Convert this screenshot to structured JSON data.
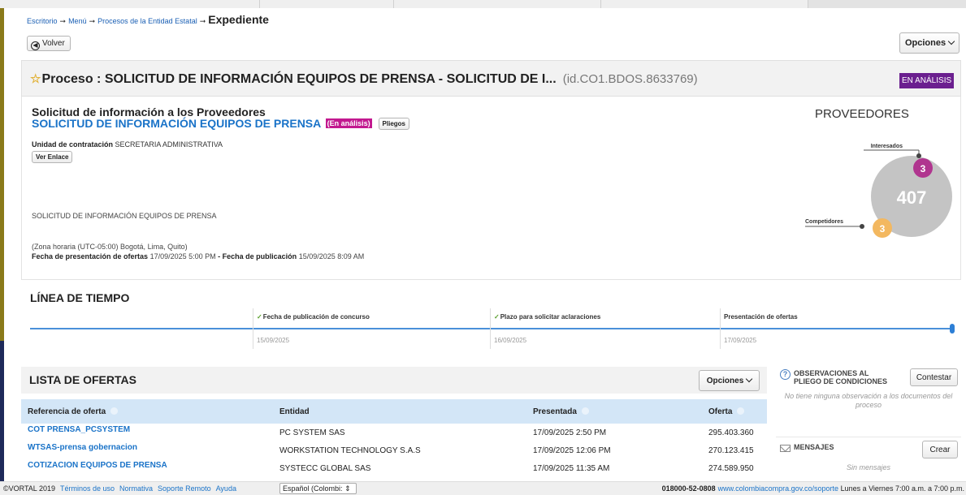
{
  "breadcrumb": {
    "items": [
      "Escritorio",
      "Menú",
      "Procesos de la Entidad Estatal"
    ],
    "current": "Expediente"
  },
  "toolbar": {
    "volver_label": "Volver",
    "opciones_label": "Opciones"
  },
  "proceso": {
    "title": "Proceso : SOLICITUD DE INFORMACIÓN EQUIPOS DE PRENSA - SOLICITUD DE I...",
    "id": "(id.CO1.BDOS.8633769)",
    "status": "EN ANÁLISIS"
  },
  "detail": {
    "heading": "Solicitud de información a los Proveedores",
    "subtitle": "SOLICITUD DE INFORMACIÓN EQUIPOS DE PRENSA",
    "badge": "(En análisis)",
    "pliegos_label": "Pliegos",
    "unidad_label": "Unidad de contratación",
    "unidad_value": "SECRETARIA ADMINISTRATIVA",
    "ver_enlace_label": "Ver Enlace",
    "description": "SOLICITUD DE INFORMACIÓN EQUIPOS DE PRENSA",
    "zona": "(Zona horaria (UTC-05:00) Bogotá, Lima, Quito)",
    "fecha_presentacion_label": "Fecha de presentación de ofertas",
    "fecha_presentacion_value": "17/09/2025 5:00 PM",
    "separator": "-",
    "fecha_publicacion_label": "Fecha de publicación",
    "fecha_publicacion_value": "15/09/2025 8:09 AM"
  },
  "proveedores": {
    "title": "PROVEEDORES",
    "total": "407",
    "interesados_label": "Interesados",
    "interesados_count": "3",
    "competidores_label": "Competidores",
    "competidores_count": "3",
    "colors": {
      "total": "#c4c4c4",
      "interesados": "#b0358f",
      "competidores": "#f3b860"
    }
  },
  "timeline": {
    "title": "LÍNEA DE TIEMPO",
    "milestones": [
      {
        "label": "Fecha de publicación de concurso",
        "date": "15/09/2025",
        "done": true
      },
      {
        "label": "Plazo para solicitar aclaraciones",
        "date": "16/09/2025",
        "done": true
      },
      {
        "label": "Presentación de ofertas",
        "date": "17/09/2025",
        "done": false
      }
    ]
  },
  "ofertas": {
    "title": "LISTA DE OFERTAS",
    "opciones_label": "Opciones",
    "columns": [
      "Referencia de oferta",
      "Entidad",
      "Presentada",
      "Oferta"
    ],
    "rows": [
      {
        "ref": "COT PRENSA_PCSYSTEM",
        "entidad": "PC SYSTEM SAS",
        "presentada": "17/09/2025 2:50 PM",
        "oferta": "295.403.360"
      },
      {
        "ref": "WTSAS-prensa gobernacion",
        "entidad": "WORKSTATION TECHNOLOGY S.A.S",
        "presentada": "17/09/2025 12:06 PM",
        "oferta": "270.123.415"
      },
      {
        "ref": "COTIZACION EQUIPOS DE PRENSA",
        "entidad": "SYSTECC GLOBAL SAS",
        "presentada": "17/09/2025 11:35 AM",
        "oferta": "274.589.950"
      }
    ]
  },
  "observaciones": {
    "title": "OBSERVACIONES AL PLIEGO DE CONDICIONES",
    "contestar_label": "Contestar",
    "empty": "No tiene ninguna observación a los documentos del proceso"
  },
  "mensajes": {
    "title": "MENSAJES",
    "crear_label": "Crear",
    "empty": "Sin mensajes"
  },
  "footer": {
    "copyright": "©VORTAL 2019",
    "links": [
      "Términos de uso",
      "Normativa",
      "Soporte Remoto",
      "Ayuda"
    ],
    "language": "Español (Colombi:",
    "phone": "018000-52-0808",
    "support_url": "www.colombiacompra.gov.co/soporte",
    "hours": "Lunes a Viernes 7:00 a.m. a 7:00 p.m."
  },
  "colors": {
    "accent": "#1a73c8",
    "status_purple": "#6b1f8f",
    "badge_magenta": "#c2188f",
    "table_header": "#d3e6f7"
  }
}
